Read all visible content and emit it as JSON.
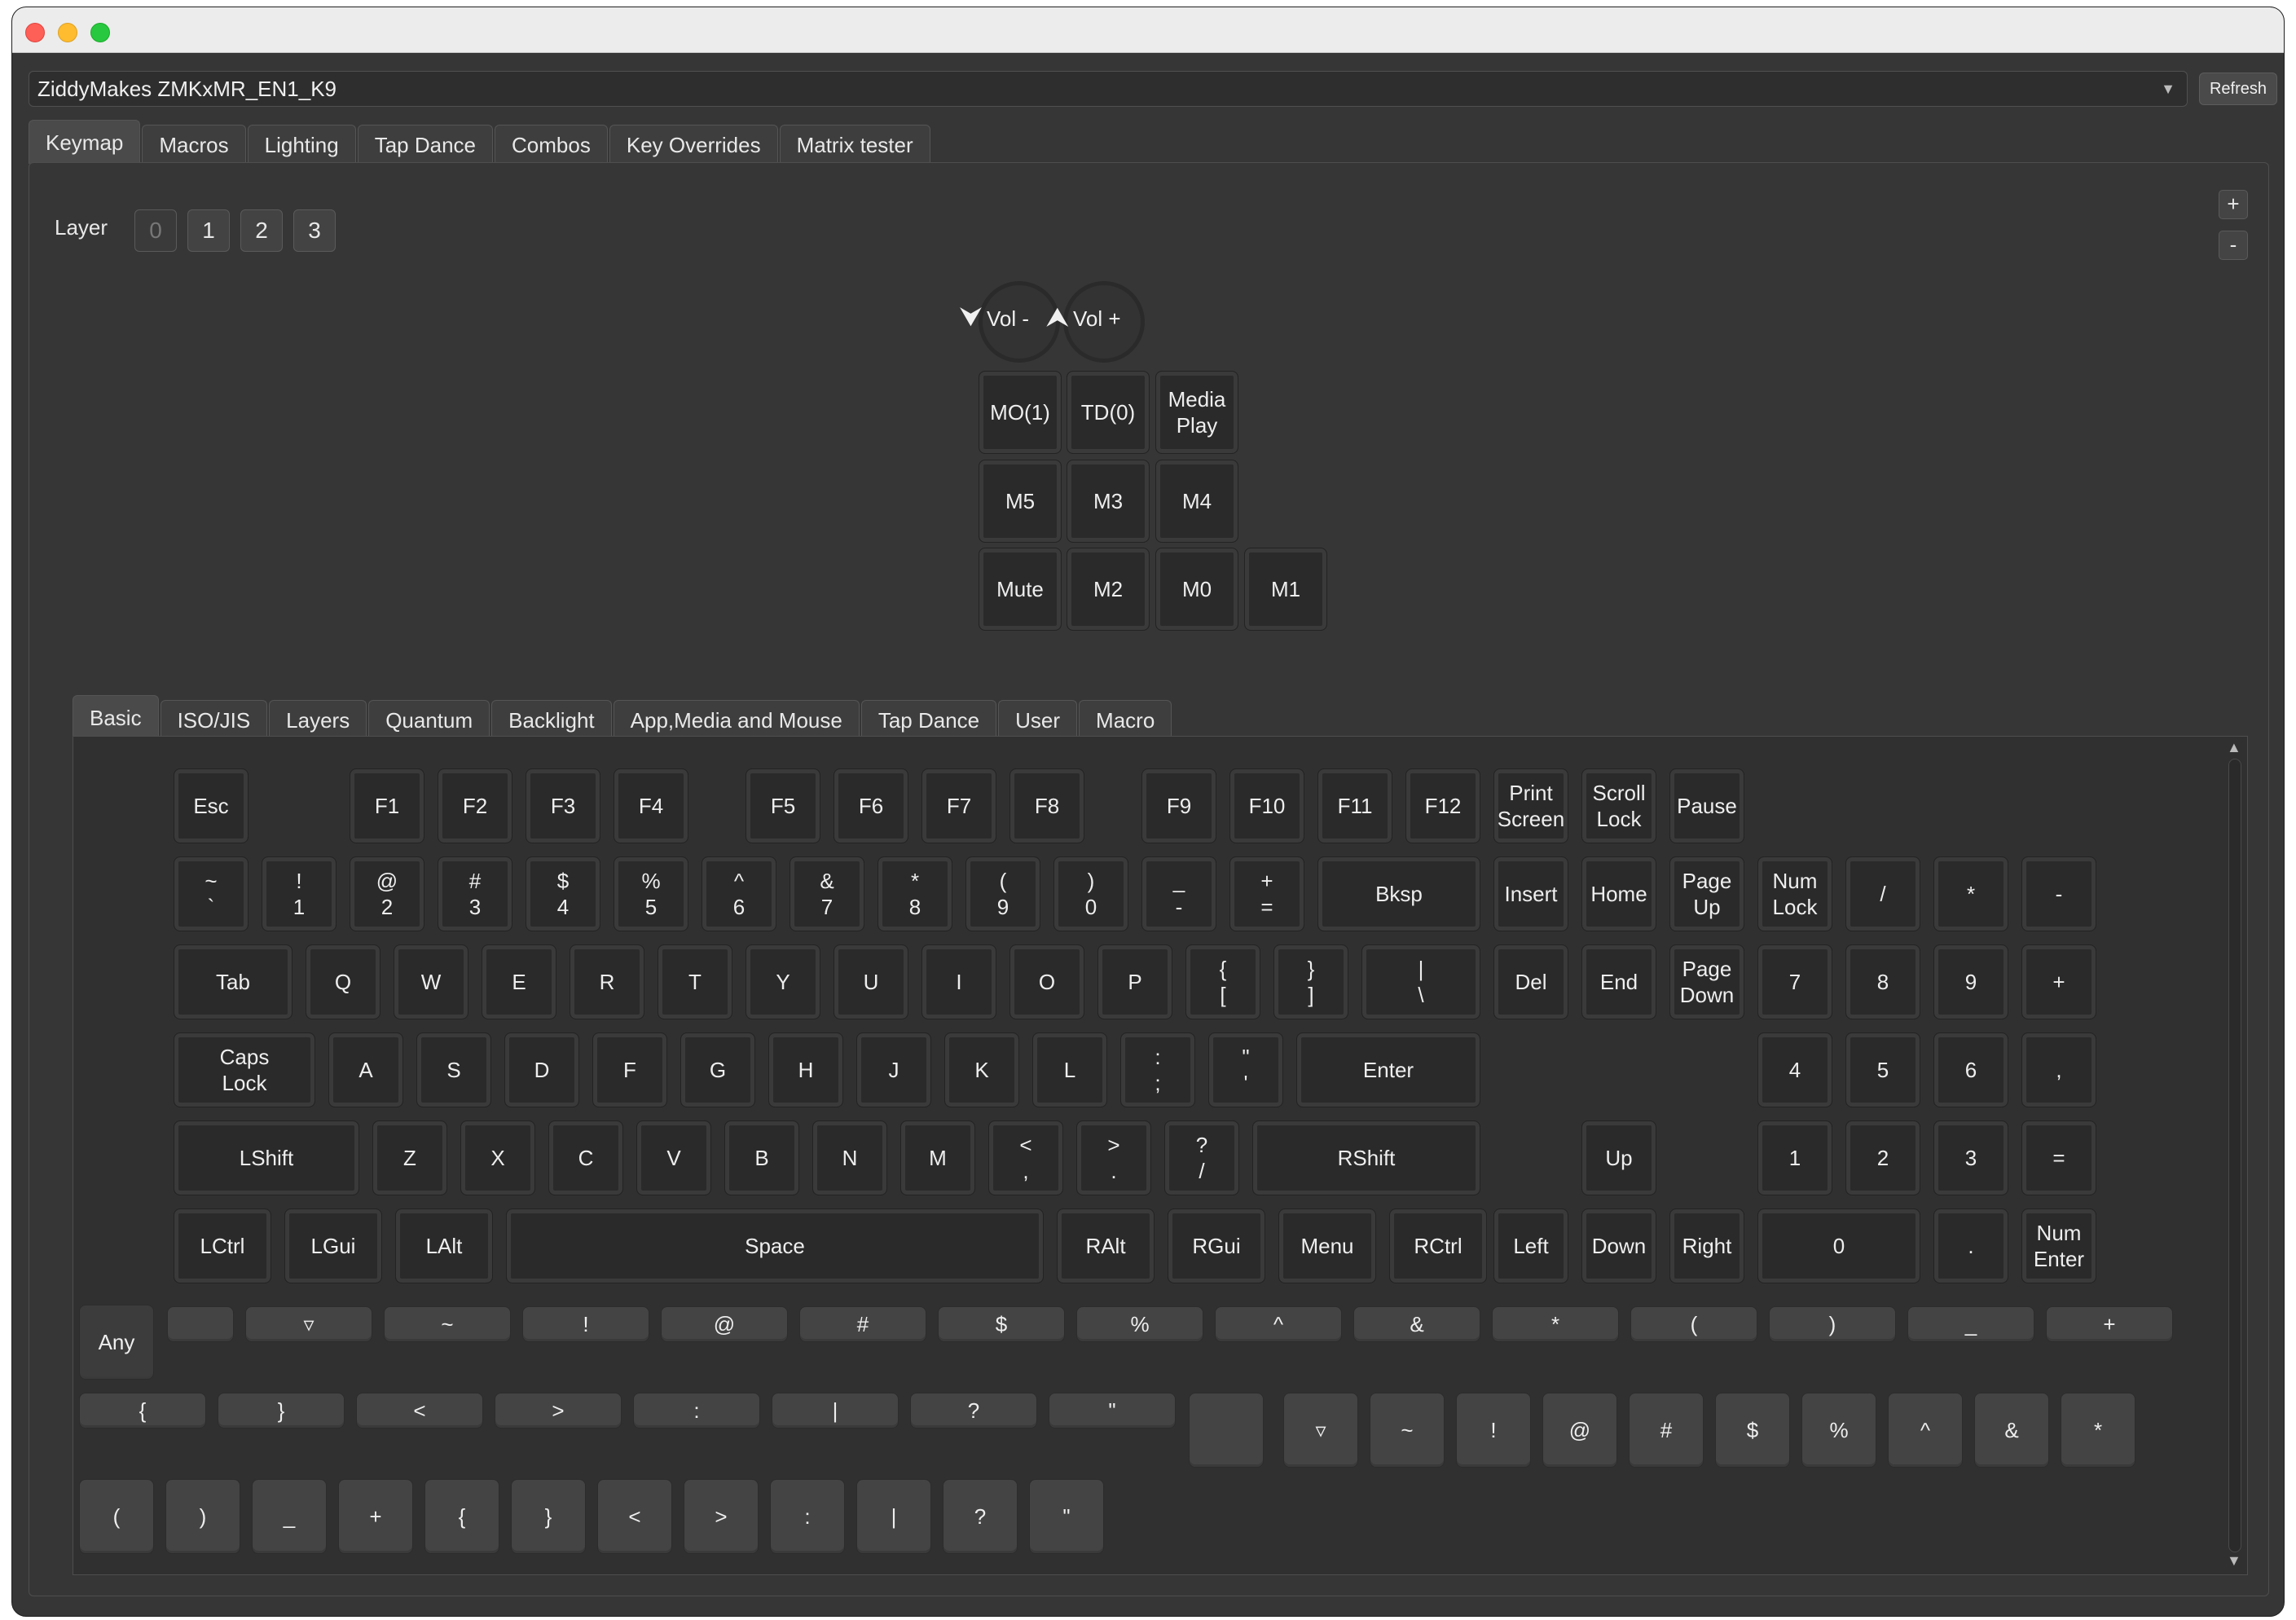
{
  "device": {
    "name": "ZiddyMakes ZMKxMR_EN1_K9",
    "refresh_label": "Refresh"
  },
  "main_tabs": [
    "Keymap",
    "Macros",
    "Lighting",
    "Tap Dance",
    "Combos",
    "Key Overrides",
    "Matrix tester"
  ],
  "main_tab_active": "Keymap",
  "layer": {
    "label": "Layer",
    "buttons": [
      "0",
      "1",
      "2",
      "3"
    ],
    "current": "0"
  },
  "zoom": {
    "plus": "+",
    "minus": "-"
  },
  "encoders": [
    {
      "label": "Vol -",
      "arrow": "⮟"
    },
    {
      "label": "Vol +",
      "arrow": "⮝"
    }
  ],
  "macropad_keys": [
    "MO(1)",
    "TD(0)",
    "Media\nPlay",
    "M5",
    "M3",
    "M4",
    "Mute",
    "M2",
    "M0",
    "M1"
  ],
  "key_tabs": [
    "Basic",
    "ISO/JIS",
    "Layers",
    "Quantum",
    "Backlight",
    "App,Media and Mouse",
    "Tap Dance",
    "User",
    "Macro"
  ],
  "key_tab_active": "Basic",
  "palette_rows": [
    [
      "Esc",
      "F1",
      "F2",
      "F3",
      "F4",
      "F5",
      "F6",
      "F7",
      "F8",
      "F9",
      "F10",
      "F11",
      "F12",
      "Print\nScreen",
      "Scroll\nLock",
      "Pause"
    ],
    [
      "~\n`",
      "!\n1",
      "@\n2",
      "#\n3",
      "$\n4",
      "%\n5",
      "^\n6",
      "&\n7",
      "*\n8",
      "(\n9",
      ")\n0",
      "_\n-",
      "+\n=",
      "Bksp",
      "Insert",
      "Home",
      "Page\nUp",
      "Num\nLock",
      "/",
      "*",
      "-"
    ],
    [
      "Tab",
      "Q",
      "W",
      "E",
      "R",
      "T",
      "Y",
      "U",
      "I",
      "O",
      "P",
      "{\n[",
      "}\n]",
      "|\n\\",
      "Del",
      "End",
      "Page\nDown",
      "7",
      "8",
      "9",
      "+"
    ],
    [
      "Caps\nLock",
      "A",
      "S",
      "D",
      "F",
      "G",
      "H",
      "J",
      "K",
      "L",
      ":\n;",
      "\"\n'",
      "Enter",
      "4",
      "5",
      "6",
      ","
    ],
    [
      "LShift",
      "Z",
      "X",
      "C",
      "V",
      "B",
      "N",
      "M",
      "<\n,",
      ">\n.",
      "?\n/",
      "RShift",
      "Up",
      "1",
      "2",
      "3",
      "="
    ],
    [
      "LCtrl",
      "LGui",
      "LAlt",
      "Space",
      "RAlt",
      "RGui",
      "Menu",
      "RCtrl",
      "Left",
      "Down",
      "Right",
      "0",
      ".",
      "Num\nEnter"
    ]
  ],
  "any_label": "Any",
  "shifted_row_1": [
    "",
    "▿",
    "~",
    "!",
    "@",
    "#",
    "$",
    "%",
    "^",
    "&",
    "*",
    "(",
    ")",
    "_",
    "+"
  ],
  "shifted_row_2": [
    "{",
    "}",
    "<",
    ">",
    ":",
    "|",
    "?",
    "\""
  ],
  "shifted_row_2_right": [
    "",
    "▿",
    "~",
    "!",
    "@",
    "#",
    "$",
    "%",
    "^",
    "&",
    "*"
  ],
  "shifted_row_3": [
    "(",
    ")",
    "_",
    "+",
    "{",
    "}",
    "<",
    ">",
    ":",
    "|",
    "?",
    "\""
  ]
}
